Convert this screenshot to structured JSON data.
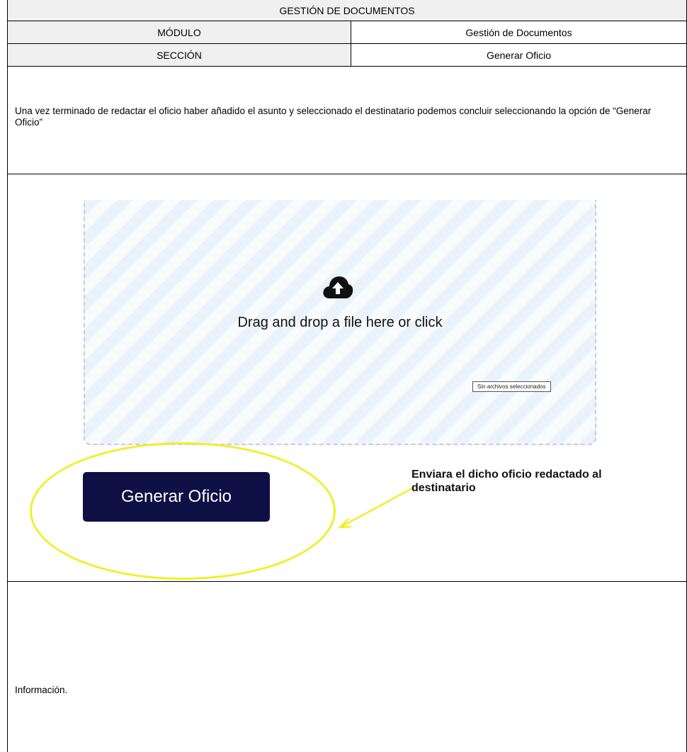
{
  "header": {
    "title": "GESTIÓN DE DOCUMENTOS",
    "rows": [
      {
        "label": "MÓDULO",
        "value": "Gestión de Documentos"
      },
      {
        "label": "SECCIÓN",
        "value": "Generar Oficio"
      }
    ]
  },
  "description": "Una vez terminado de redactar el oficio haber añadido el asunto y seleccionado el destinatario podemos concluir seleccionando la opción de “Generar Oficio”",
  "screenshot": {
    "upload_icon": "cloud-upload-icon",
    "dropzone_text": "Drag and drop a file here or click",
    "no_file_text": "Sin archivos seleccionados",
    "button_label": "Generar Oficio",
    "callout_text": "Enviara el dicho oficio redactado al destinatario",
    "button_color": "#0e0f44",
    "highlight_color": "#f3ee2a"
  },
  "info": "Información."
}
